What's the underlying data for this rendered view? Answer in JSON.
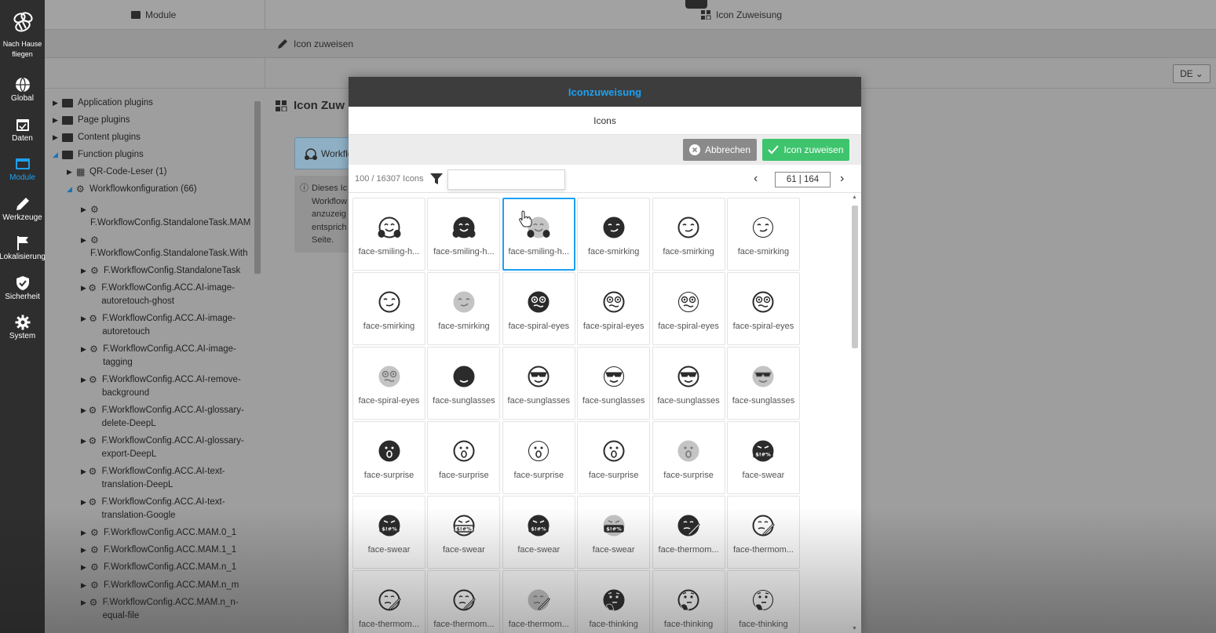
{
  "nav": {
    "home_label": "Nach Hause fliegen",
    "items": [
      {
        "label": "Global",
        "icon": "globe-icon"
      },
      {
        "label": "Daten",
        "icon": "calendar-icon"
      },
      {
        "label": "Module",
        "icon": "window-icon",
        "active": true
      },
      {
        "label": "Werkzeuge",
        "icon": "pencil-icon"
      },
      {
        "label": "Lokalisierung",
        "icon": "flag-icon"
      },
      {
        "label": "Sicherheit",
        "icon": "shield-icon"
      },
      {
        "label": "System",
        "icon": "gear-icon"
      }
    ]
  },
  "tabs": {
    "module": "Module",
    "icon_assign": "Icon Zuweisung"
  },
  "subbar": {
    "edit_label": "Icon zuweisen"
  },
  "lang": {
    "value": "DE"
  },
  "tree": {
    "items": [
      {
        "label": "Application plugins"
      },
      {
        "label": "Page plugins"
      },
      {
        "label": "Content plugins"
      },
      {
        "label": "Function plugins"
      },
      {
        "label": "QR-Code-Leser (1)"
      },
      {
        "label": "Workflowkonfiguration (66)"
      },
      {
        "label": "F.WorkflowConfig.StandaloneTask.MAM"
      },
      {
        "label": "F.WorkflowConfig.StandaloneTask.With"
      },
      {
        "label": "F.WorkflowConfig.StandaloneTask"
      },
      {
        "label": "F.WorkflowConfig.ACC.AI-image-autoretouch-ghost"
      },
      {
        "label": "F.WorkflowConfig.ACC.AI-image-autoretouch"
      },
      {
        "label": "F.WorkflowConfig.ACC.AI-image-tagging"
      },
      {
        "label": "F.WorkflowConfig.ACC.AI-remove-background"
      },
      {
        "label": "F.WorkflowConfig.ACC.AI-glossary-delete-DeepL"
      },
      {
        "label": "F.WorkflowConfig.ACC.AI-glossary-export-DeepL"
      },
      {
        "label": "F.WorkflowConfig.ACC.AI-text-translation-DeepL"
      },
      {
        "label": "F.WorkflowConfig.ACC.AI-text-translation-Google"
      },
      {
        "label": "F.WorkflowConfig.ACC.MAM.0_1"
      },
      {
        "label": "F.WorkflowConfig.ACC.MAM.1_1"
      },
      {
        "label": "F.WorkflowConfig.ACC.MAM.n_1"
      },
      {
        "label": "F.WorkflowConfig.ACC.MAM.n_m"
      },
      {
        "label": "F.WorkflowConfig.ACC.MAM.n_n-equal-file"
      }
    ]
  },
  "page": {
    "title": "Icon Zuw",
    "wf_button": "Workflo",
    "info_text": "Dieses Ic Workflow anzuzeig entsprich Seite."
  },
  "modal": {
    "title": "Iconzuweisung",
    "subtitle": "Icons",
    "cancel_label": "Abbrechen",
    "assign_label": "Icon zuweisen",
    "count": "100 / 16307 Icons",
    "search_value": "",
    "page_indicator": "61 | 164",
    "icons": [
      {
        "name": "face-smiling-h...",
        "style": "outline-hands"
      },
      {
        "name": "face-smiling-h...",
        "style": "solid-hands"
      },
      {
        "name": "face-smiling-h...",
        "style": "duo-hands",
        "selected": true
      },
      {
        "name": "face-smirking",
        "style": "solid"
      },
      {
        "name": "face-smirking",
        "style": "outline"
      },
      {
        "name": "face-smirking",
        "style": "thin"
      },
      {
        "name": "face-smirking",
        "style": "outline"
      },
      {
        "name": "face-smirking",
        "style": "duo"
      },
      {
        "name": "face-spiral-eyes",
        "style": "solid-spiral"
      },
      {
        "name": "face-spiral-eyes",
        "style": "outline-spiral"
      },
      {
        "name": "face-spiral-eyes",
        "style": "thin-spiral"
      },
      {
        "name": "face-spiral-eyes",
        "style": "outline-spiral"
      },
      {
        "name": "face-spiral-eyes",
        "style": "duo-spiral"
      },
      {
        "name": "face-sunglasses",
        "style": "solid-glasses"
      },
      {
        "name": "face-sunglasses",
        "style": "outline-glasses"
      },
      {
        "name": "face-sunglasses",
        "style": "thin-glasses"
      },
      {
        "name": "face-sunglasses",
        "style": "outline-glasses"
      },
      {
        "name": "face-sunglasses",
        "style": "duo-glasses"
      },
      {
        "name": "face-surprise",
        "style": "solid-o"
      },
      {
        "name": "face-surprise",
        "style": "outline-o"
      },
      {
        "name": "face-surprise",
        "style": "thin-o"
      },
      {
        "name": "face-surprise",
        "style": "outline-o"
      },
      {
        "name": "face-surprise",
        "style": "duo-o"
      },
      {
        "name": "face-swear",
        "style": "solid-swear"
      },
      {
        "name": "face-swear",
        "style": "solid-swear"
      },
      {
        "name": "face-swear",
        "style": "outline-swear"
      },
      {
        "name": "face-swear",
        "style": "solid-swear"
      },
      {
        "name": "face-swear",
        "style": "duo-swear"
      },
      {
        "name": "face-thermom...",
        "style": "solid-thermo"
      },
      {
        "name": "face-thermom...",
        "style": "outline-thermo"
      },
      {
        "name": "face-thermom...",
        "style": "outline-thermo"
      },
      {
        "name": "face-thermom...",
        "style": "outline-thermo"
      },
      {
        "name": "face-thermom...",
        "style": "duo-thermo"
      },
      {
        "name": "face-thinking",
        "style": "solid-think"
      },
      {
        "name": "face-thinking",
        "style": "outline-think"
      },
      {
        "name": "face-thinking",
        "style": "thin-think"
      }
    ]
  },
  "colors": {
    "accent": "#1da1f2",
    "success": "#3ec46d",
    "nav_bg": "#2e2e2e",
    "modal_header": "#3d3d3d"
  }
}
